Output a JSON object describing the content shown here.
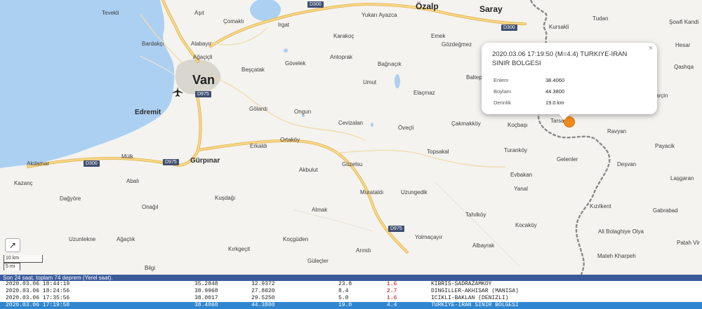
{
  "map": {
    "places": [
      {
        "name": "Tevekli"
      },
      {
        "name": "Aşıt"
      },
      {
        "name": "Çomaklı"
      },
      {
        "name": "Irgat"
      },
      {
        "name": "Yukarı Ayazca"
      },
      {
        "name": "Özalp"
      },
      {
        "name": "Saray"
      },
      {
        "name": "Kursakli"
      },
      {
        "name": "Tudan"
      },
      {
        "name": "Şowfi Kandi"
      },
      {
        "name": "Bardakçı"
      },
      {
        "name": "Alabayır"
      },
      {
        "name": "Karakoç"
      },
      {
        "name": "Emek"
      },
      {
        "name": "Gözdeğmez"
      },
      {
        "name": "Hesar"
      },
      {
        "name": "Ağaçiçli"
      },
      {
        "name": "Gövelek"
      },
      {
        "name": "Antoprak"
      },
      {
        "name": "Qashqa"
      },
      {
        "name": "Beşçatak"
      },
      {
        "name": "Bağrıaçık"
      },
      {
        "name": "Van"
      },
      {
        "name": "Umut"
      },
      {
        "name": "Elaçmaz"
      },
      {
        "name": "Baltep"
      },
      {
        "name": "Kafarçin"
      },
      {
        "name": "Edremit"
      },
      {
        "name": "Gölardı"
      },
      {
        "name": "Ongun"
      },
      {
        "name": "Cevizalan"
      },
      {
        "name": "Öveçli"
      },
      {
        "name": "Çakmakköy"
      },
      {
        "name": "Koçbaşı"
      },
      {
        "name": "Tarsa"
      },
      {
        "name": "Ravyan"
      },
      {
        "name": "Erkaldı"
      },
      {
        "name": "Ortaköy"
      },
      {
        "name": "Payacik"
      },
      {
        "name": "Topsakal"
      },
      {
        "name": "Turanköy"
      },
      {
        "name": "Mülk"
      },
      {
        "name": "Gürpınar"
      },
      {
        "name": "Akdamar"
      },
      {
        "name": "Güzelsu"
      },
      {
        "name": "Akbulut"
      },
      {
        "name": "Gelenler"
      },
      {
        "name": "Deşvan"
      },
      {
        "name": "Evbakan"
      },
      {
        "name": "Kazanç"
      },
      {
        "name": "Abalı"
      },
      {
        "name": "Laşgaran"
      },
      {
        "name": "Murataldı"
      },
      {
        "name": "Uzungedik"
      },
      {
        "name": "Yanal"
      },
      {
        "name": "Dağyöre"
      },
      {
        "name": "Kuşdağı"
      },
      {
        "name": "Onağıl"
      },
      {
        "name": "Almak"
      },
      {
        "name": "Kızılkent"
      },
      {
        "name": "Gabrabad"
      },
      {
        "name": "Tahılköy"
      },
      {
        "name": "Kocaköy"
      },
      {
        "name": "Uzuntekne"
      },
      {
        "name": "Ağaçlık"
      },
      {
        "name": "Koçgüden"
      },
      {
        "name": "Yolmaçayır"
      },
      {
        "name": "Ali Bolaghiye Olya"
      },
      {
        "name": "Albayrak"
      },
      {
        "name": "Patah Vir"
      },
      {
        "name": "Kırkgeçit"
      },
      {
        "name": "Arındı"
      },
      {
        "name": "Güleçler"
      },
      {
        "name": "Mateh Kharpeh"
      },
      {
        "name": "Bilgi"
      }
    ],
    "road_shields": [
      {
        "label": "D300"
      },
      {
        "label": "D300"
      },
      {
        "label": "D975"
      },
      {
        "label": "D975"
      },
      {
        "label": "D300"
      },
      {
        "label": "D975"
      }
    ],
    "scale": {
      "km": "10 km",
      "mi": "5 mi"
    },
    "expand_symbol": "↗",
    "colors": {
      "water": "#acd0f2",
      "city": "#d9d6ce",
      "road": "#f4c96a",
      "border": "#8a8a8a",
      "marker": "#f08b1a"
    }
  },
  "popup": {
    "title": "2020.03.06 17:19:50 (M=4.4) TURKIYE-IRAN SINIR BOLGESI",
    "close": "×",
    "fields": [
      {
        "label": "Enlem",
        "value": "38.4060"
      },
      {
        "label": "Boylam",
        "value": "44.3800"
      },
      {
        "label": "Derinlik",
        "value": "19.0 km"
      }
    ]
  },
  "panel": {
    "header": "Son 24 saat, toplam 74 deprem (Yerel saat).",
    "rows": [
      {
        "time": "2020.03.06 18:44:19",
        "lat": "35.2848",
        "lon": "32.9372",
        "depth": "23.8",
        "mag": "1.6",
        "place": "KIBRIS-SADRAZAMKOY"
      },
      {
        "time": "2020.03.06 18:24:56",
        "lat": "38.9968",
        "lon": "27.8820",
        "depth": "8.4",
        "mag": "2.7",
        "place": "DINGILLER-AKHISAR (MANISA)"
      },
      {
        "time": "2020.03.06 17:35:56",
        "lat": "38.0017",
        "lon": "29.5250",
        "depth": "5.0",
        "mag": "1.6",
        "place": "ICIKLI-BAKLAN (DENIZLI)"
      },
      {
        "time": "2020.03.06 17:19:50",
        "lat": "38.4060",
        "lon": "44.3800",
        "depth": "19.0",
        "mag": "4.4",
        "place": "TURKIYE-IRAN SINIR BOLGESI",
        "selected": true
      }
    ]
  }
}
